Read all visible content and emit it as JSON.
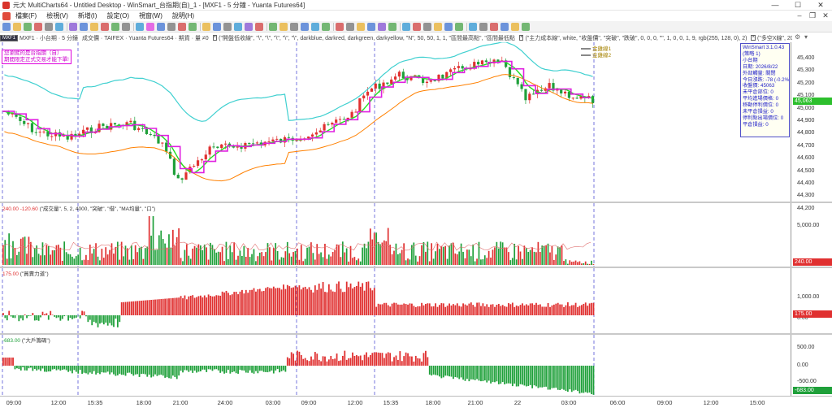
{
  "window": {
    "title": "元大 MultiCharts64 - Untitled Desktop - WinSmart_台指期(自)_1 - [MXF1 - 5 分鐘 - Yuanta Futures64]",
    "minimize": "—",
    "maximize": "☐",
    "close": "✕"
  },
  "menu": {
    "items": [
      "檔案(F)",
      "檢視(V)",
      "新增(I)",
      "設定(O)",
      "視窗(W)",
      "說明(H)"
    ],
    "mdi_min": "–",
    "mdi_restore": "❐",
    "mdi_close": "✕"
  },
  "chart_info": {
    "symbol_badge": "MXF1",
    "items": [
      "MXF1 · 小台期 · 5 分鐘",
      "成交價 · TAIFEX · Yuanta Futures64 · 期貨 · 量 ≠0",
      "(\"開盤低收線\", \"\\\", \"\\\", \"\\\", \"\\\", \"\\\", darkblue, darkred, darkgreen, darkyellow, \"N\", 50, 50, 1, 1, \"區間最高點\", \"區間最低點",
      "(\"主力成本線\", white, \"收盤價\", \"突破\", \"跌破\", 0, 0, 0, \"\", 1, 0, 0, 1, 9, rgb(255, 128, 0), 2)",
      "(\"多空X線\", 20)"
    ]
  },
  "price_panel": {
    "warning_line1": "您瀏覽的是台指期（自）",
    "warning_line2": "期間限定正式交易才能下單!",
    "legend": [
      "金雞線1",
      "金雞線2"
    ],
    "info_box": [
      "WinSmart 3.1.0.43",
      "(策略 1)",
      "小台期",
      "日期: 2026/8/22",
      "外部觸量: 關閉",
      "今日漲跌: -78 (-0.2%)",
      "收盤價: 45063",
      "未平倉部位: 0",
      "平均進場價格: 0",
      "移動停利價位: 0",
      "未平倉損益: 0",
      "停利點出場價位: 0",
      "平倉損益: 0"
    ],
    "last_price": "45,063",
    "y_ticks": [
      "45,400",
      "45,300",
      "45,200",
      "45,100",
      "45,000",
      "44,900",
      "44,800",
      "44,700",
      "44,600",
      "44,500",
      "44,400",
      "44,300",
      "44,200"
    ]
  },
  "volume_panel": {
    "title_value": "240.00",
    "title_value2": "-120.60",
    "title": "(\"成交量\", 5, 2, 4000, \"突破\", \"借\", \"MA均量\", \"口\")",
    "y_ticks": [
      "5,000.00"
    ],
    "last_value": "240.00"
  },
  "buysell_panel": {
    "title_value": "175.00",
    "title": "(\"買賣力道\")",
    "y_ticks": [
      "1,000.00",
      "0.00"
    ],
    "last_value": "175.00"
  },
  "bigplayer_panel": {
    "title_value": "-683.00",
    "title": "(\"大戶籌碼\")",
    "y_ticks": [
      "500.00",
      "0.00",
      "-500.00"
    ],
    "last_value": "-683.00"
  },
  "x_axis": {
    "ticks": [
      "09:00",
      "12:00",
      "15:35",
      "18:00",
      "21:00",
      "24:00",
      "03:00",
      "09:00",
      "12:00",
      "15:35",
      "18:00",
      "21:00",
      "22",
      "03:00",
      "06:00",
      "09:00",
      "12:00",
      "15:00"
    ]
  },
  "colors": {
    "up": "#e03030",
    "down": "#1fa03a",
    "ma_magenta": "#e020e0",
    "ma_green": "#22dd22",
    "band_cyan": "#40d0d0",
    "cost_orange": "#ff8000",
    "session_line": "#3b3bd0"
  }
}
